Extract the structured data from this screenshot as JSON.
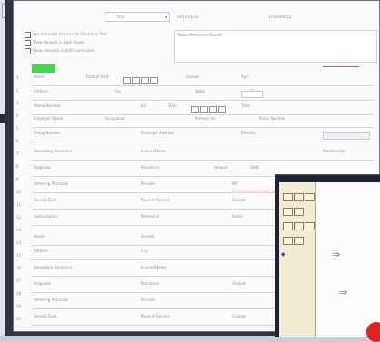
{
  "window": {
    "title": ""
  },
  "top_bar": {
    "dropdown_value": "Year",
    "field_a": "2018/12/12",
    "field_b": "1234/000/12"
  },
  "options": [
    {
      "label": "Use Alternate Address for Electronic Mail"
    },
    {
      "label": "Show Amount in Both Views"
    },
    {
      "label": "Show amounts in both currencies"
    }
  ],
  "notes_label": "Notes/Reference Details",
  "left_numbers": [
    "1",
    "2",
    "3",
    "4",
    "5",
    "6",
    "7",
    "8",
    "9",
    "10",
    "11",
    "12",
    "13",
    "14",
    "15",
    "16",
    "17",
    "18",
    "19",
    "20"
  ],
  "form_rows": [
    {
      "labels": [
        "Name",
        "Date of Birth",
        "Gender",
        "Age"
      ]
    },
    {
      "labels": [
        "Address",
        "City",
        "State",
        "Zip"
      ]
    },
    {
      "labels": [
        "Phone Number",
        "Ext",
        "Date",
        "Time"
      ]
    },
    {
      "labels": [
        "Employer Name",
        "Occupation",
        "Primary Ins",
        "Policy Number"
      ]
    },
    {
      "labels": [
        "Group Number",
        "Employer Address",
        "Effective"
      ]
    },
    {
      "labels": [
        "Secondary Insurance",
        "Insured Name",
        "Relationship"
      ]
    },
    {
      "labels": [
        "Diagnosis",
        "Procedure",
        "Amount",
        "Units"
      ]
    },
    {
      "labels": [
        "Referring Physician",
        "Provider",
        "NPI"
      ]
    },
    {
      "labels": [
        "Service Date",
        "Place of Service",
        "Charges"
      ]
    },
    {
      "labels": [
        "Authorization",
        "Reference",
        "Notes"
      ]
    }
  ],
  "popup": {
    "toolbar_glyph": "◆",
    "arrow_1": "⇒",
    "arrow_2": "⇒"
  }
}
